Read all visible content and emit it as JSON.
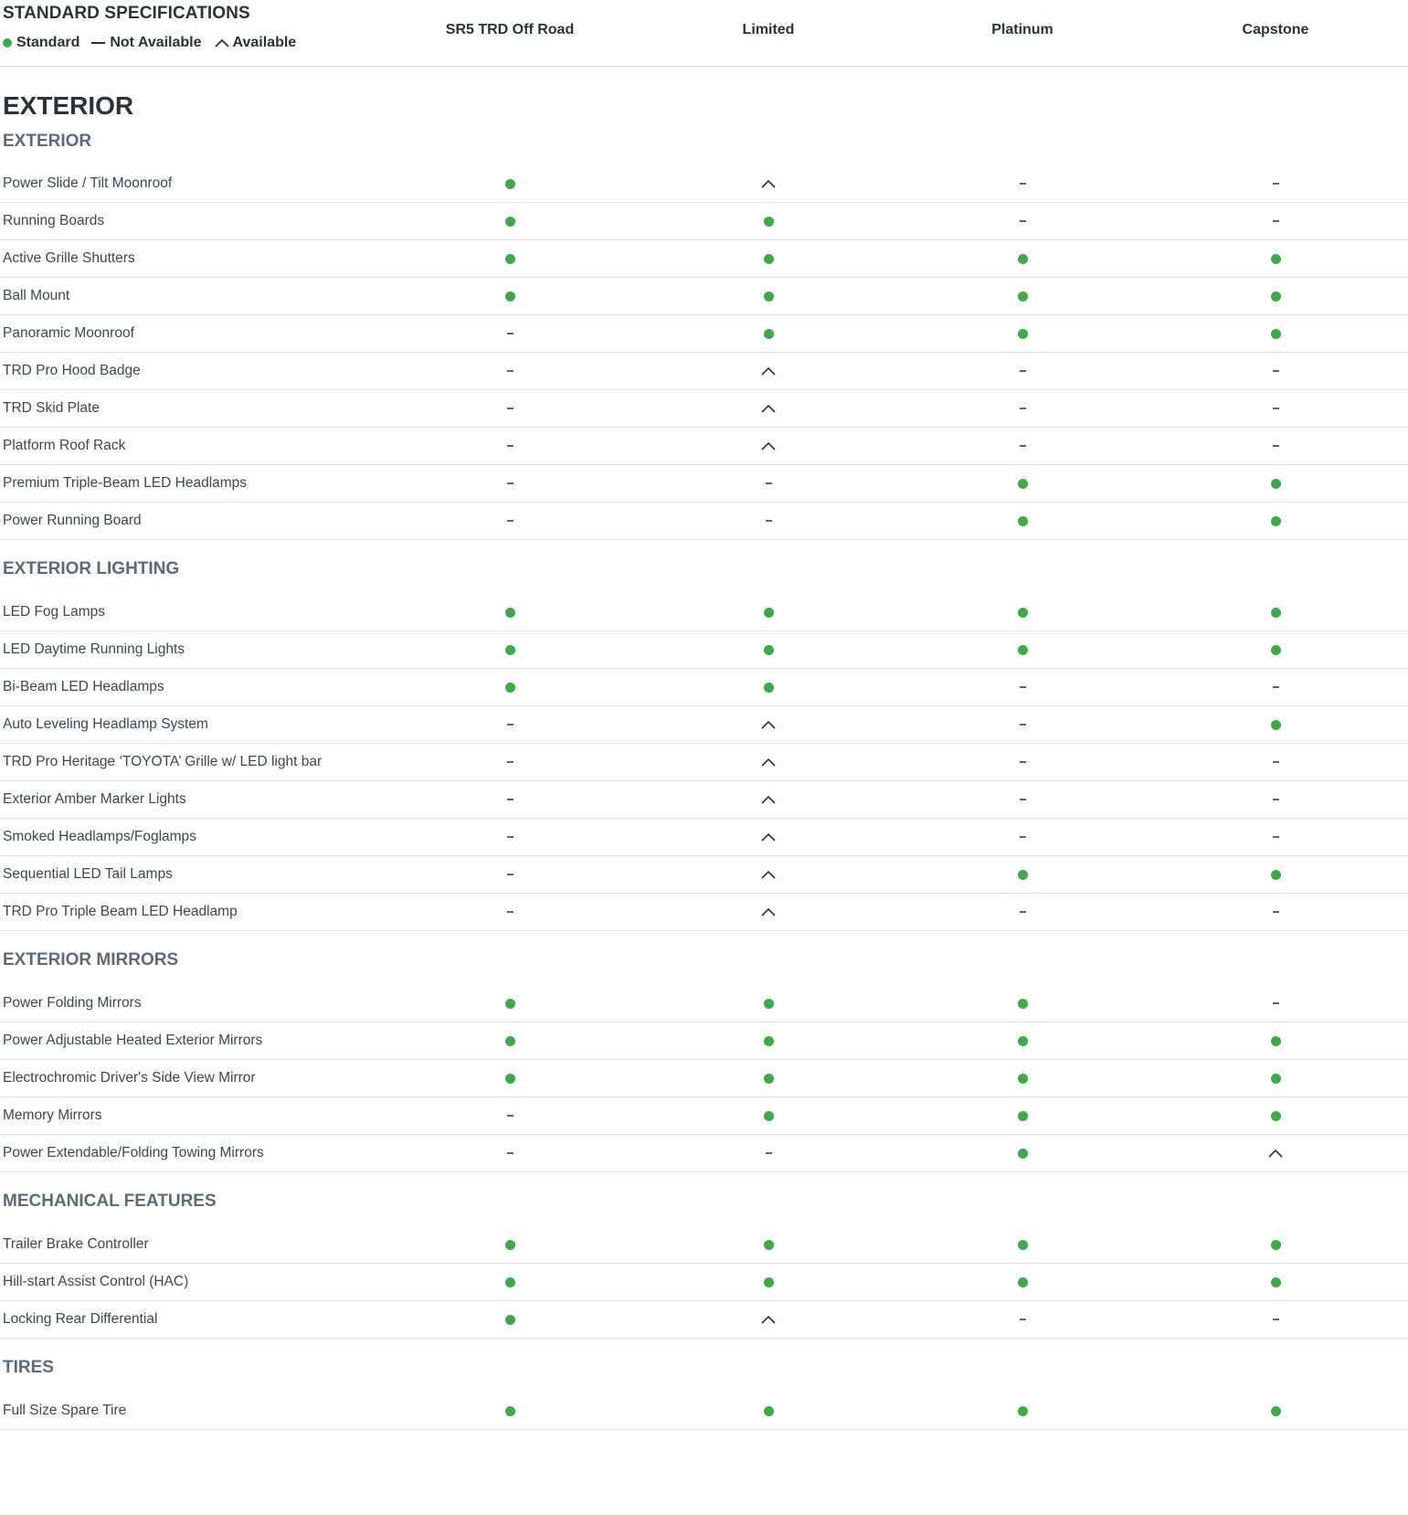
{
  "header": {
    "title": "STANDARD SPECIFICATIONS",
    "legend": [
      {
        "symbol": "standard",
        "label": "Standard"
      },
      {
        "symbol": "not-available",
        "label": "Not Available"
      },
      {
        "symbol": "available",
        "label": "Available"
      }
    ],
    "trims": [
      "SR5 TRD Off Road",
      "Limited",
      "Platinum",
      "Capstone"
    ]
  },
  "colors": {
    "standard_dot": "#3aab47",
    "heading": "#2b3338",
    "group_heading": "#5c6b78",
    "divider": "#e1e4e6"
  },
  "section": {
    "title": "EXTERIOR",
    "groups": [
      {
        "title": "EXTERIOR",
        "rows": [
          {
            "label": "Power Slide / Tilt Moonroof",
            "values": [
              "standard",
              "available",
              "not-available",
              "not-available"
            ]
          },
          {
            "label": "Running Boards",
            "values": [
              "standard",
              "standard",
              "not-available",
              "not-available"
            ]
          },
          {
            "label": "Active Grille Shutters",
            "values": [
              "standard",
              "standard",
              "standard",
              "standard"
            ]
          },
          {
            "label": "Ball Mount",
            "values": [
              "standard",
              "standard",
              "standard",
              "standard"
            ]
          },
          {
            "label": "Panoramic Moonroof",
            "values": [
              "not-available",
              "standard",
              "standard",
              "standard"
            ]
          },
          {
            "label": "TRD Pro Hood Badge",
            "values": [
              "not-available",
              "available",
              "not-available",
              "not-available"
            ]
          },
          {
            "label": "TRD Skid Plate",
            "values": [
              "not-available",
              "available",
              "not-available",
              "not-available"
            ]
          },
          {
            "label": "Platform Roof Rack",
            "values": [
              "not-available",
              "available",
              "not-available",
              "not-available"
            ]
          },
          {
            "label": "Premium Triple-Beam LED Headlamps",
            "values": [
              "not-available",
              "not-available",
              "standard",
              "standard"
            ]
          },
          {
            "label": "Power Running Board",
            "values": [
              "not-available",
              "not-available",
              "standard",
              "standard"
            ]
          }
        ]
      },
      {
        "title": "EXTERIOR LIGHTING",
        "rows": [
          {
            "label": "LED Fog Lamps",
            "values": [
              "standard",
              "standard",
              "standard",
              "standard"
            ]
          },
          {
            "label": "LED Daytime Running Lights",
            "values": [
              "standard",
              "standard",
              "standard",
              "standard"
            ]
          },
          {
            "label": "Bi-Beam LED Headlamps",
            "values": [
              "standard",
              "standard",
              "not-available",
              "not-available"
            ]
          },
          {
            "label": "Auto Leveling Headlamp System",
            "values": [
              "not-available",
              "available",
              "not-available",
              "standard"
            ]
          },
          {
            "label": "TRD Pro Heritage ‘TOYOTA’ Grille w/ LED light bar",
            "values": [
              "not-available",
              "available",
              "not-available",
              "not-available"
            ]
          },
          {
            "label": "Exterior Amber Marker Lights",
            "values": [
              "not-available",
              "available",
              "not-available",
              "not-available"
            ]
          },
          {
            "label": "Smoked Headlamps/Foglamps",
            "values": [
              "not-available",
              "available",
              "not-available",
              "not-available"
            ]
          },
          {
            "label": "Sequential LED Tail Lamps",
            "values": [
              "not-available",
              "available",
              "standard",
              "standard"
            ]
          },
          {
            "label": "TRD Pro Triple Beam LED Headlamp",
            "values": [
              "not-available",
              "available",
              "not-available",
              "not-available"
            ]
          }
        ]
      },
      {
        "title": "EXTERIOR MIRRORS",
        "rows": [
          {
            "label": "Power Folding Mirrors",
            "values": [
              "standard",
              "standard",
              "standard",
              "not-available"
            ]
          },
          {
            "label": "Power Adjustable Heated Exterior Mirrors",
            "values": [
              "standard",
              "standard",
              "standard",
              "standard"
            ]
          },
          {
            "label": "Electrochromic Driver's Side View Mirror",
            "values": [
              "standard",
              "standard",
              "standard",
              "standard"
            ]
          },
          {
            "label": "Memory Mirrors",
            "values": [
              "not-available",
              "standard",
              "standard",
              "standard"
            ]
          },
          {
            "label": "Power Extendable/Folding Towing Mirrors",
            "values": [
              "not-available",
              "not-available",
              "standard",
              "available"
            ]
          }
        ]
      },
      {
        "title": "MECHANICAL FEATURES",
        "rows": [
          {
            "label": "Trailer Brake Controller",
            "values": [
              "standard",
              "standard",
              "standard",
              "standard"
            ]
          },
          {
            "label": "Hill-start Assist Control (HAC)",
            "values": [
              "standard",
              "standard",
              "standard",
              "standard"
            ]
          },
          {
            "label": "Locking Rear Differential",
            "values": [
              "standard",
              "available",
              "not-available",
              "not-available"
            ]
          }
        ]
      },
      {
        "title": "TIRES",
        "rows": [
          {
            "label": "Full Size Spare Tire",
            "values": [
              "standard",
              "standard",
              "standard",
              "standard"
            ]
          }
        ]
      }
    ]
  }
}
